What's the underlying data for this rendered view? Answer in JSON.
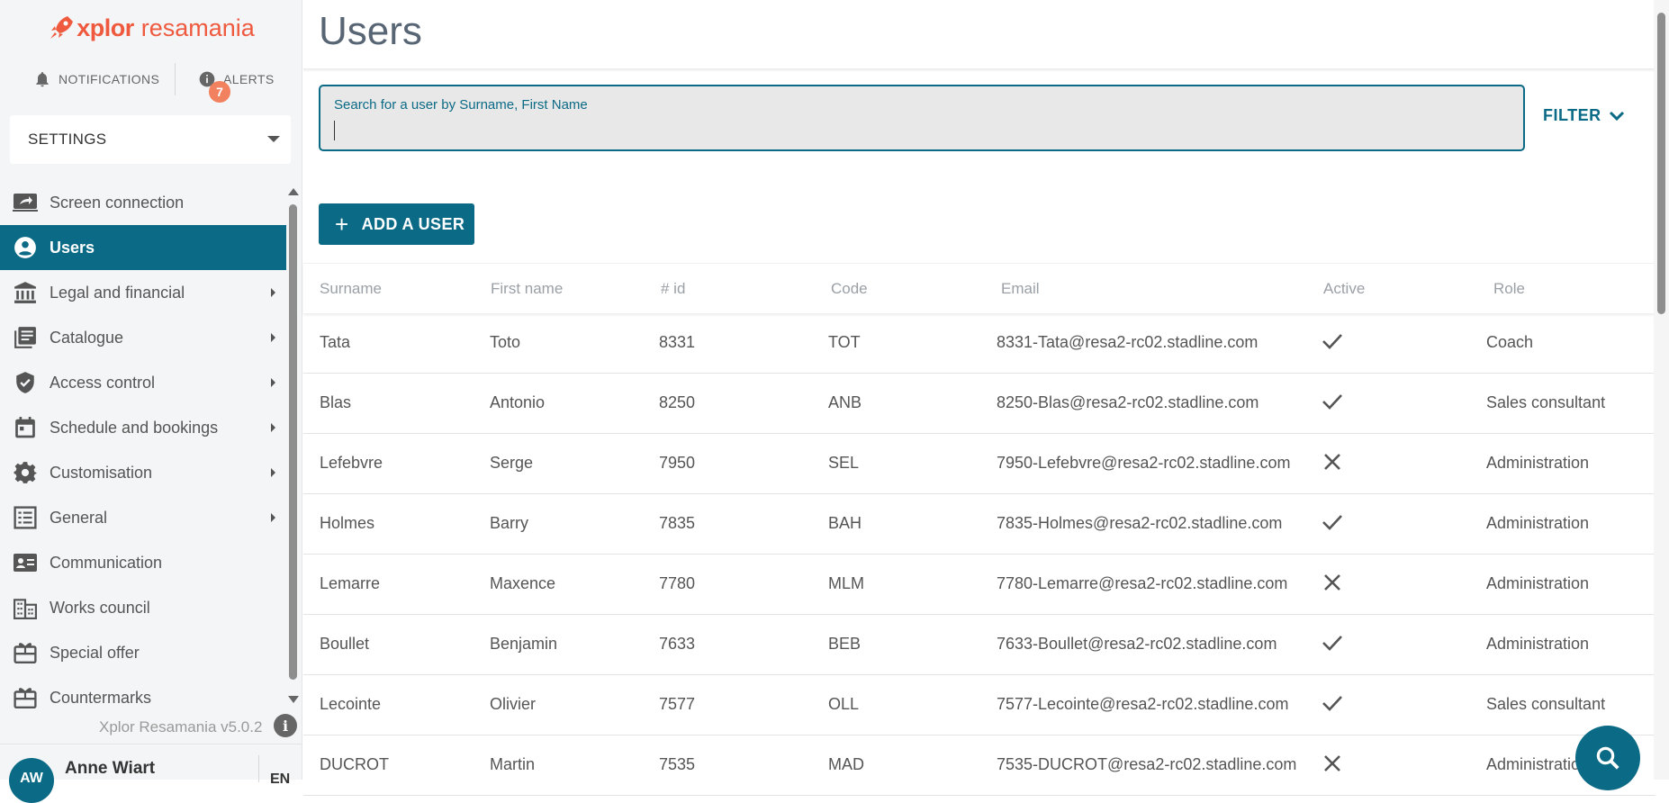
{
  "brand": {
    "logo_icon": "xplor-rocket-icon",
    "name": "xplor",
    "product": "resamania",
    "color": "#ef5a3f"
  },
  "topnav": {
    "notifications_label": "NOTIFICATIONS",
    "alerts_label": "ALERTS",
    "alerts_count": "7"
  },
  "settings_select": {
    "value": "SETTINGS"
  },
  "sidebar": {
    "items": [
      {
        "label": "Screen connection",
        "icon": "screen-share-icon",
        "submenu": false,
        "active": false
      },
      {
        "label": "Users",
        "icon": "user-circle-icon",
        "submenu": false,
        "active": true
      },
      {
        "label": "Legal and financial",
        "icon": "bank-icon",
        "submenu": true,
        "active": false
      },
      {
        "label": "Catalogue",
        "icon": "catalogue-icon",
        "submenu": true,
        "active": false
      },
      {
        "label": "Access control",
        "icon": "shield-check-icon",
        "submenu": true,
        "active": false
      },
      {
        "label": "Schedule and bookings",
        "icon": "calendar-icon",
        "submenu": true,
        "active": false
      },
      {
        "label": "Customisation",
        "icon": "gear-icon",
        "submenu": true,
        "active": false
      },
      {
        "label": "General",
        "icon": "list-icon",
        "submenu": true,
        "active": false
      },
      {
        "label": "Communication",
        "icon": "contact-card-icon",
        "submenu": false,
        "active": false
      },
      {
        "label": "Works council",
        "icon": "building-icon",
        "submenu": false,
        "active": false
      },
      {
        "label": "Special offer",
        "icon": "gift-card-icon",
        "submenu": false,
        "active": false
      },
      {
        "label": "Countermarks",
        "icon": "ticket-icon",
        "submenu": false,
        "active": false
      }
    ],
    "version": "Xplor Resamania v5.0.2"
  },
  "user": {
    "initials": "AW",
    "name": "Anne Wiart",
    "language": "EN"
  },
  "main": {
    "title": "Users",
    "search": {
      "label": "Search for a user by Surname, First Name",
      "value": ""
    },
    "filter_label": "FILTER",
    "add_button_label": "ADD A USER",
    "table": {
      "columns": [
        "Surname",
        "First name",
        "# id",
        "Code",
        "Email",
        "Active",
        "Role"
      ],
      "rows": [
        {
          "surname": "Tata",
          "first_name": "Toto",
          "id": "8331",
          "code": "TOT",
          "email": "8331-Tata@resa2-rc02.stadline.com",
          "active": true,
          "role": "Coach"
        },
        {
          "surname": "Blas",
          "first_name": "Antonio",
          "id": "8250",
          "code": "ANB",
          "email": "8250-Blas@resa2-rc02.stadline.com",
          "active": true,
          "role": "Sales consultant"
        },
        {
          "surname": "Lefebvre",
          "first_name": "Serge",
          "id": "7950",
          "code": "SEL",
          "email": "7950-Lefebvre@resa2-rc02.stadline.com",
          "active": false,
          "role": "Administration"
        },
        {
          "surname": "Holmes",
          "first_name": "Barry",
          "id": "7835",
          "code": "BAH",
          "email": "7835-Holmes@resa2-rc02.stadline.com",
          "active": true,
          "role": "Administration"
        },
        {
          "surname": "Lemarre",
          "first_name": "Maxence",
          "id": "7780",
          "code": "MLM",
          "email": "7780-Lemarre@resa2-rc02.stadline.com",
          "active": false,
          "role": "Administration"
        },
        {
          "surname": "Boullet",
          "first_name": "Benjamin",
          "id": "7633",
          "code": "BEB",
          "email": "7633-Boullet@resa2-rc02.stadline.com",
          "active": true,
          "role": "Administration"
        },
        {
          "surname": "Lecointe",
          "first_name": "Olivier",
          "id": "7577",
          "code": "OLL",
          "email": "7577-Lecointe@resa2-rc02.stadline.com",
          "active": true,
          "role": "Sales consultant"
        },
        {
          "surname": "DUCROT",
          "first_name": "Martin",
          "id": "7535",
          "code": "MAD",
          "email": "7535-DUCROT@resa2-rc02.stadline.com",
          "active": false,
          "role": "Administration"
        }
      ]
    }
  },
  "colors": {
    "accent": "#0b6a85",
    "badge": "#f28160",
    "sidebar_bg": "#f4f5f6"
  }
}
